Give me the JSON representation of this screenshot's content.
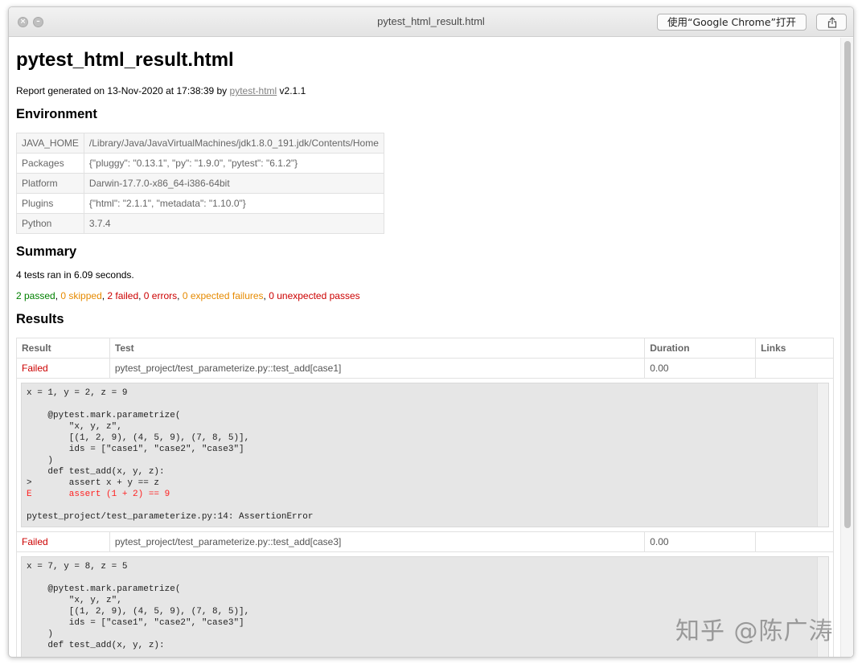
{
  "window": {
    "title": "pytest_html_result.html",
    "open_button": "使用“Google Chrome”打开"
  },
  "report": {
    "heading": "pytest_html_result.html",
    "generated_prefix": "Report generated on 13-Nov-2020 at 17:38:39 by ",
    "generated_link": "pytest-html",
    "generated_suffix": " v2.1.1"
  },
  "environment": {
    "heading": "Environment",
    "rows": [
      {
        "key": "JAVA_HOME",
        "value": "/Library/Java/JavaVirtualMachines/jdk1.8.0_191.jdk/Contents/Home"
      },
      {
        "key": "Packages",
        "value": "{\"pluggy\": \"0.13.1\", \"py\": \"1.9.0\", \"pytest\": \"6.1.2\"}"
      },
      {
        "key": "Platform",
        "value": "Darwin-17.7.0-x86_64-i386-64bit"
      },
      {
        "key": "Plugins",
        "value": "{\"html\": \"2.1.1\", \"metadata\": \"1.10.0\"}"
      },
      {
        "key": "Python",
        "value": "3.7.4"
      }
    ]
  },
  "summary": {
    "heading": "Summary",
    "ran": "4 tests ran in 6.09 seconds.",
    "passed": "2 passed",
    "skipped": "0 skipped",
    "failed": "2 failed",
    "errors": "0 errors",
    "xfailed": "0 expected failures",
    "xpassed": "0 unexpected passes",
    "sep": ", "
  },
  "results": {
    "heading": "Results",
    "columns": [
      "Result",
      "Test",
      "Duration",
      "Links"
    ],
    "rows": [
      {
        "result": "Failed",
        "test": "pytest_project/test_parameterize.py::test_add[case1]",
        "duration": "0.00",
        "links": "",
        "log_pre": "x = 1, y = 2, z = 9\n\n    @pytest.mark.parametrize(\n        \"x, y, z\",\n        [(1, 2, 9), (4, 5, 9), (7, 8, 5)],\n        ids = [\"case1\", \"case2\", \"case3\"]\n    )\n    def test_add(x, y, z):\n>       assert x + y == z",
        "log_err": "E       assert (1 + 2) == 9",
        "log_post": "\npytest_project/test_parameterize.py:14: AssertionError"
      },
      {
        "result": "Failed",
        "test": "pytest_project/test_parameterize.py::test_add[case3]",
        "duration": "0.00",
        "links": "",
        "log_pre": "x = 7, y = 8, z = 5\n\n    @pytest.mark.parametrize(\n        \"x, y, z\",\n        [(1, 2, 9), (4, 5, 9), (7, 8, 5)],\n        ids = [\"case1\", \"case2\", \"case3\"]\n    )\n    def test_add(x, y, z):"
      }
    ]
  },
  "watermark": "知乎 @陈广涛",
  "colors": {
    "passed": "#008000",
    "skipped": "#e68a00",
    "failed": "#cc0000",
    "log_bg": "#e6e6e6"
  }
}
